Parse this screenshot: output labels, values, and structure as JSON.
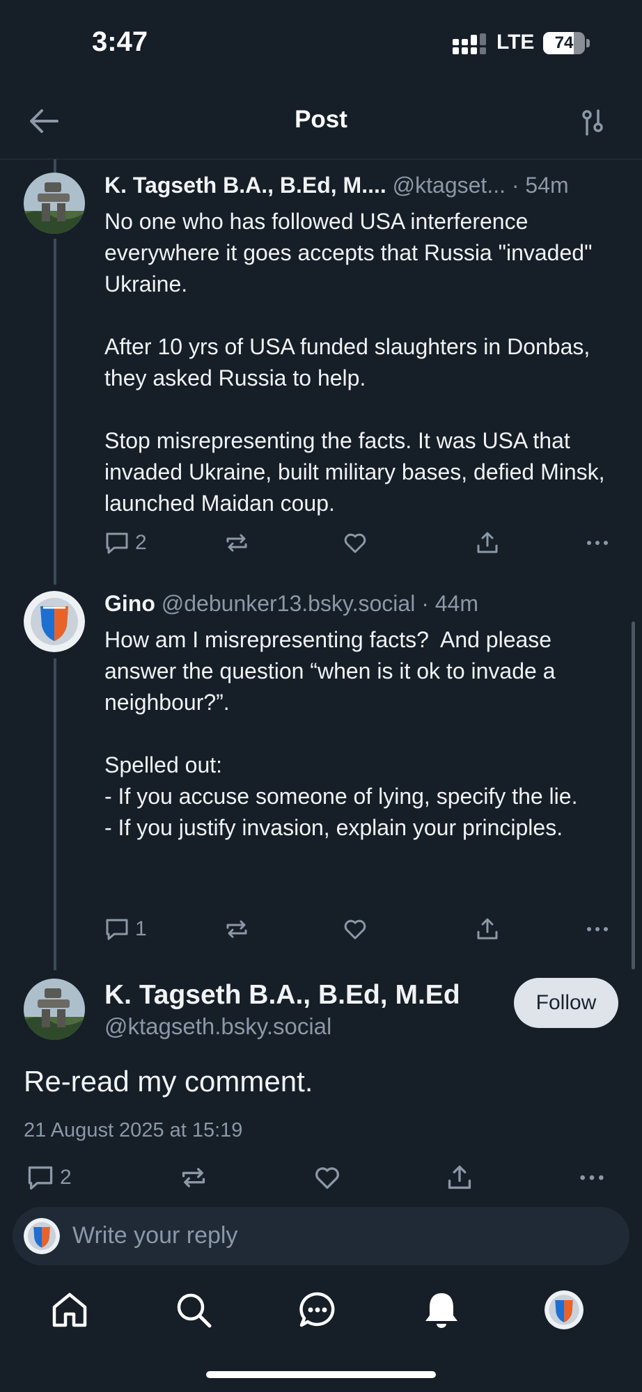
{
  "status": {
    "time": "3:47",
    "network": "LTE",
    "battery": "74",
    "battery_level": 0.74
  },
  "header": {
    "title": "Post"
  },
  "posts": [
    {
      "author": "K. Tagseth B.A., B.Ed, M....",
      "handle": "@ktagset...",
      "time": "· 54m",
      "text": "No one who has followed USA interference everywhere it goes accepts that Russia \"invaded\" Ukraine.\n\nAfter 10 yrs of USA funded slaughters in Donbas, they asked Russia to help.\n\nStop misrepresenting the facts. It was USA that invaded Ukraine, built military bases, defied Minsk, launched Maidan coup.",
      "replies": "2"
    },
    {
      "author": "Gino",
      "handle": "@debunker13.bsky.social",
      "time": "· 44m",
      "text": "How am I misrepresenting facts?  And please answer the question “when is it ok to invade a neighbour?”.\n\nSpelled out:\n- If you accuse someone of lying, specify the lie.\n- If you justify invasion, explain your principles.",
      "replies": "1"
    }
  ],
  "main_post": {
    "author": "K. Tagseth B.A., B.Ed, M.Ed",
    "handle": "@ktagseth.bsky.social",
    "follow_label": "Follow",
    "text": "Re-read my comment.",
    "timestamp": "21 August 2025 at 15:19",
    "replies": "2"
  },
  "reply_box": {
    "placeholder": "Write your reply"
  },
  "icons": {
    "back": "arrow-left-icon",
    "filter": "sliders-icon",
    "reply": "comment-icon",
    "repost": "repost-icon",
    "like": "heart-icon",
    "share": "share-icon",
    "more": "more-icon",
    "tabs": [
      "home-icon",
      "search-icon",
      "chat-icon",
      "bell-icon",
      "profile-avatar"
    ]
  },
  "colors": {
    "background": "#161e27",
    "muted": "#8b98a7",
    "thread": "#3a4a5c"
  }
}
